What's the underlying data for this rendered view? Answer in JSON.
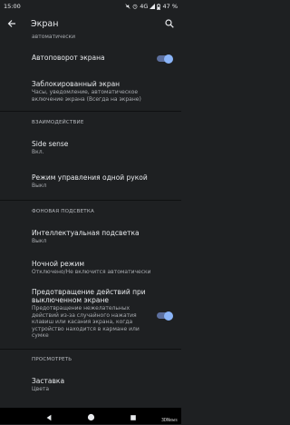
{
  "status_bar": {
    "time": "15:00",
    "network": "4G",
    "battery": "47 %"
  },
  "app_bar": {
    "title": "Экран"
  },
  "items": {
    "auto_fade": {
      "subtitle": "автоматически"
    },
    "autorotate": {
      "title": "Автоповорот экрана",
      "toggle_on": true
    },
    "lock_screen": {
      "title": "Заблокированный экран",
      "subtitle": "Часы, уведомление, автоматическое включение экрана (Всегда на экране)"
    },
    "side_sense": {
      "title": "Side sense",
      "subtitle": "Вкл."
    },
    "one_hand": {
      "title": "Режим управления одной рукой",
      "subtitle": "Выкл"
    },
    "smart_backlight": {
      "title": "Интеллектуальная подсветка",
      "subtitle": "Выкл"
    },
    "night_mode": {
      "title": "Ночной режим",
      "subtitle": "Отключено/Не включится автоматически"
    },
    "accidental": {
      "title": "Предотвращение действий при выключенном экране",
      "subtitle": "Предотвращение нежелательных действий из-за случайного нажатия клавиш или касания экрана, когда устройство находится в кармане или сумке",
      "toggle_on": true
    },
    "screensaver": {
      "title": "Заставка",
      "subtitle": "Цвета"
    }
  },
  "sections": {
    "interaction": "ВЗАИМОДЕЙСТВИЕ",
    "backlight": "ФОНОВАЯ ПОДСВЕТКА",
    "view": "ПРОСМОТРЕТЬ"
  },
  "watermark": "3DNews",
  "icons": {
    "back": "arrow-back-icon",
    "search": "search-icon",
    "nav_back": "triangle-back-icon",
    "nav_home": "home-circle-icon",
    "nav_recent": "square-recent-icon"
  },
  "colors": {
    "background": "#1e2022",
    "accent": "#8ab4f8",
    "toggle_track": "#5c6f9e"
  }
}
